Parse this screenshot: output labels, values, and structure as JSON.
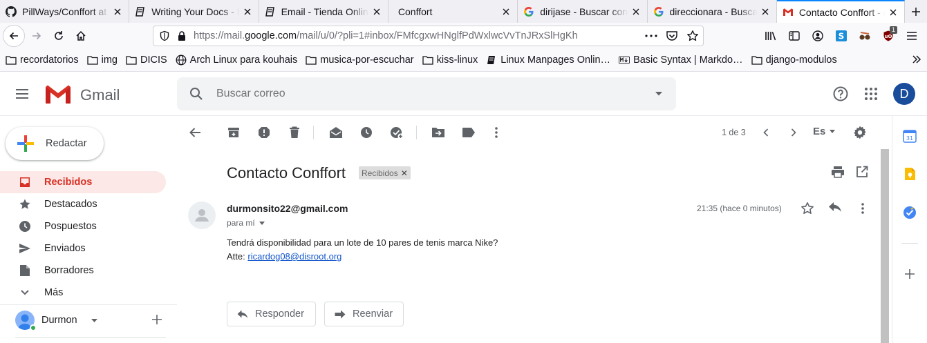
{
  "browser": {
    "tabs": [
      {
        "label": "PillWays/Conffort at",
        "icon": "github-icon"
      },
      {
        "label": "Writing Your Docs - M",
        "icon": "book-icon"
      },
      {
        "label": "Email - Tienda Online",
        "icon": "book-icon"
      },
      {
        "label": "Conffort",
        "icon": "none"
      },
      {
        "label": "dirijase - Buscar con",
        "icon": "google-icon"
      },
      {
        "label": "direccionara - Buscar",
        "icon": "google-icon"
      },
      {
        "label": "Contacto Conffort - d",
        "icon": "gmail-icon",
        "active": true
      }
    ],
    "url_prefix": "https://mail.",
    "url_domain": "google.com",
    "url_rest": "/mail/u/0/?pli=1#inbox/FMfcgxwHNglfPdWxlwcVvTnJRxSlHgKh",
    "ublock_badge": "1",
    "bookmarks": [
      {
        "label": "recordatorios",
        "icon": "folder-icon"
      },
      {
        "label": "img",
        "icon": "folder-icon"
      },
      {
        "label": "DICIS",
        "icon": "folder-icon"
      },
      {
        "label": "Arch Linux para kouhais",
        "icon": "globe-icon"
      },
      {
        "label": "musica-por-escuchar",
        "icon": "folder-icon"
      },
      {
        "label": "kiss-linux",
        "icon": "folder-icon"
      },
      {
        "label": "Linux Manpages Onlin…",
        "icon": "book-icon"
      },
      {
        "label": "Basic Syntax | Markdo…",
        "icon": "markdown-icon"
      },
      {
        "label": "django-modulos",
        "icon": "folder-icon"
      }
    ]
  },
  "gmail": {
    "brand": "Gmail",
    "search_placeholder": "Buscar correo",
    "avatar_letter": "D",
    "compose_label": "Redactar",
    "nav": [
      {
        "label": "Recibidos",
        "icon": "inbox-icon",
        "active": true
      },
      {
        "label": "Destacados",
        "icon": "star-icon"
      },
      {
        "label": "Pospuestos",
        "icon": "clock-icon"
      },
      {
        "label": "Enviados",
        "icon": "send-icon"
      },
      {
        "label": "Borradores",
        "icon": "draft-icon"
      },
      {
        "label": "Más",
        "icon": "chevron-down-icon"
      }
    ],
    "hangouts_user": "Durmon",
    "pager": "1 de 3",
    "input_language": "Es",
    "message": {
      "subject": "Contacto Conffort",
      "label": "Recibidos",
      "sender": "durmonsito22@gmail.com",
      "to": "para mí",
      "time": "21:35 (hace 0 minutos)",
      "body_line1": "Tendrá disponibilidad para un lote de 10 pares de tenis marca Nike?",
      "body_line2_prefix": "Atte: ",
      "body_link": "ricardog08@disroot.org",
      "reply_label": "Responder",
      "forward_label": "Reenviar"
    },
    "side_panel": [
      "calendar-icon",
      "keep-icon",
      "tasks-icon",
      "add-icon"
    ],
    "colors": {
      "accent_red": "#d93025",
      "active_bg": "#fce8e6",
      "link": "#1155cc",
      "tab_accent": "#0a84ff"
    }
  }
}
